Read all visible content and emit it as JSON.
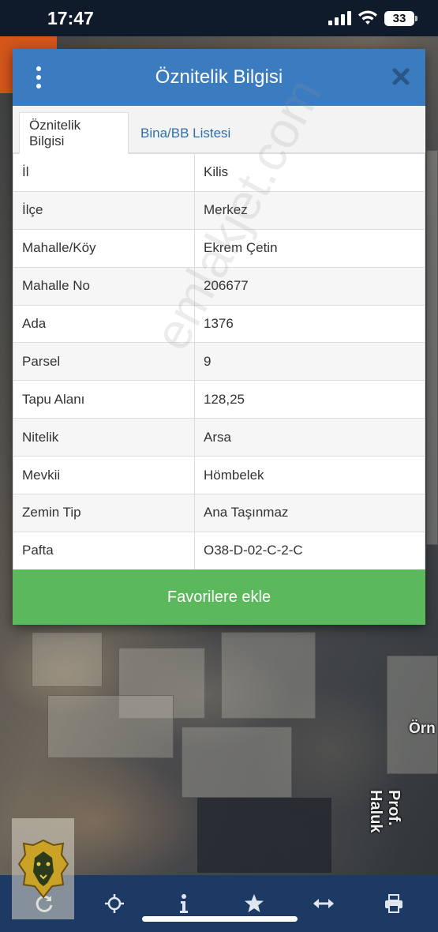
{
  "status_bar": {
    "time": "17:47",
    "battery": "33"
  },
  "dialog": {
    "title": "Öznitelik Bilgisi",
    "tabs": [
      {
        "label": "Öznitelik Bilgisi",
        "active": true
      },
      {
        "label": "Bina/BB Listesi",
        "active": false
      }
    ],
    "rows": [
      {
        "key": "İl",
        "value": "Kilis"
      },
      {
        "key": "İlçe",
        "value": "Merkez"
      },
      {
        "key": "Mahalle/Köy",
        "value": "Ekrem Çetin"
      },
      {
        "key": "Mahalle No",
        "value": "206677"
      },
      {
        "key": "Ada",
        "value": "1376"
      },
      {
        "key": "Parsel",
        "value": "9"
      },
      {
        "key": "Tapu Alanı",
        "value": "128,25"
      },
      {
        "key": "Nitelik",
        "value": "Arsa"
      },
      {
        "key": "Mevkii",
        "value": "Hömbelek"
      },
      {
        "key": "Zemin Tip",
        "value": "Ana Taşınmaz"
      },
      {
        "key": "Pafta",
        "value": "O38-D-02-C-2-C"
      }
    ],
    "favorite_button": "Favorilere ekle"
  },
  "map": {
    "road_label_1": "Prof. Haluk",
    "road_label_2": "Örn"
  },
  "watermark": "emlakjet.com",
  "colors": {
    "header": "#3b7bc0",
    "button": "#5cb85c",
    "toolbar": "#1c3a64",
    "tab_link": "#2f6fa8"
  },
  "toolbar": [
    "refresh-icon",
    "locate-icon",
    "info-icon",
    "star-icon",
    "measure-icon",
    "print-icon"
  ]
}
